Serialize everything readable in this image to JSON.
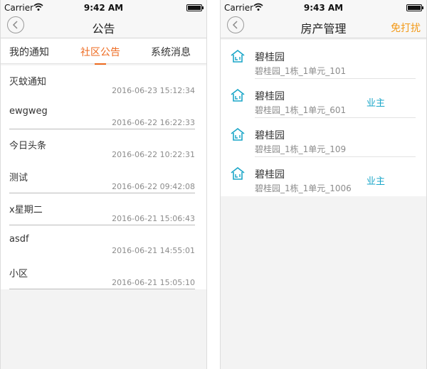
{
  "left_screen": {
    "status": {
      "carrier": "Carrier",
      "time": "9:42 AM"
    },
    "nav": {
      "title": "公告",
      "back_icon": "chevron-left-icon"
    },
    "tabs": [
      {
        "label": "我的通知",
        "active": false
      },
      {
        "label": "社区公告",
        "active": true
      },
      {
        "label": "系统消息",
        "active": false
      }
    ],
    "notices": [
      {
        "title": "灭蚊通知",
        "time": "2016-06-23 15:12:34"
      },
      {
        "title": "ewgweg",
        "time": "2016-06-22 16:22:33"
      },
      {
        "title": "今日头条",
        "time": "2016-06-22 10:22:31"
      },
      {
        "title": "测试",
        "time": "2016-06-22 09:42:08"
      },
      {
        "title": "x星期二",
        "time": "2016-06-21 15:06:43"
      },
      {
        "title": "asdf",
        "time": "2016-06-21 14:55:01"
      },
      {
        "title": "小区",
        "time": "2016-06-21 15:05:10"
      }
    ]
  },
  "right_screen": {
    "status": {
      "carrier": "Carrier",
      "time": "9:43 AM"
    },
    "nav": {
      "title": "房产管理",
      "right_action": "免打扰",
      "back_icon": "chevron-left-icon"
    },
    "houses": [
      {
        "name": "碧桂园",
        "address": "碧桂园_1栋_1单元_101",
        "role": ""
      },
      {
        "name": "碧桂园",
        "address": "碧桂园_1栋_1单元_601",
        "role": "业主"
      },
      {
        "name": "碧桂园",
        "address": "碧桂园_1栋_1单元_109",
        "role": ""
      },
      {
        "name": "碧桂园",
        "address": "碧桂园_1栋_1单元_1006",
        "role": "业主"
      }
    ]
  },
  "colors": {
    "accent_orange": "#ee6a1f",
    "action_orange": "#f39a18",
    "teal": "#1aa6c8",
    "background": "#f3f3f3"
  }
}
